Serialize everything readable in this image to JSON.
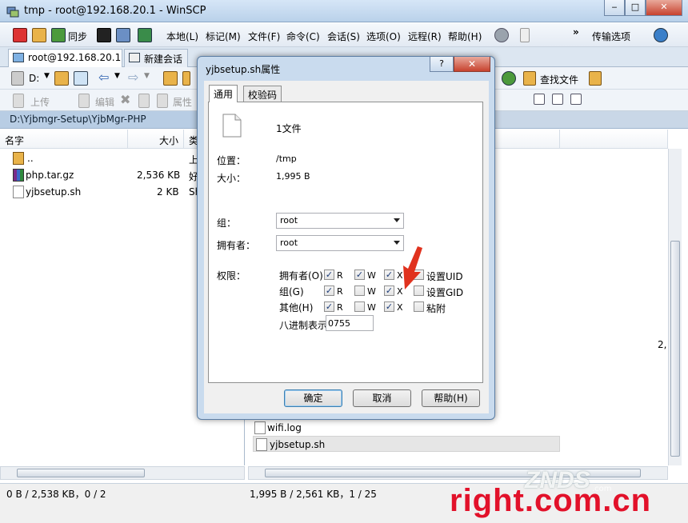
{
  "window": {
    "title": "tmp - root@192.168.20.1 - WinSCP",
    "minimize": "‒",
    "maximize": "□",
    "close": "✕"
  },
  "menu": {
    "sync_label": "同步",
    "items": [
      "本地(L)",
      "标记(M)",
      "文件(F)",
      "命令(C)",
      "会话(S)",
      "选项(O)",
      "远程(R)",
      "帮助(H)"
    ],
    "overflow": "»",
    "transfer_options": "传输选项"
  },
  "tabs": {
    "session": "root@192.168.20.1",
    "new_session": "新建会话"
  },
  "left_toolbar": {
    "drive": "D:",
    "upload": "上传",
    "edit": "编辑",
    "properties": "属性"
  },
  "right_toolbar": {
    "find_files": "查找文件"
  },
  "left_panel": {
    "path": "D:\\Yjbmgr-Setup\\YjbMgr-PHP",
    "columns": {
      "name": "名字",
      "size": "大小",
      "type_partial": "类"
    },
    "rows": [
      {
        "name": "..",
        "size": "",
        "type": "上"
      },
      {
        "name": "php.tar.gz",
        "size": "2,536 KB",
        "type": "好"
      },
      {
        "name": "yjbsetup.sh",
        "size": "2 KB",
        "type": "Sh"
      }
    ]
  },
  "right_panel": {
    "rows": [
      {
        "name": "wifi.log"
      },
      {
        "name": "yjbsetup.sh"
      }
    ],
    "edge_text": "2,"
  },
  "status": {
    "left": "0 B / 2,538 KB，0 / 2",
    "right": "1,995 B / 2,561 KB，1 / 25"
  },
  "dialog": {
    "title": "yjbsetup.sh属性",
    "help": "?",
    "close": "✕",
    "tabs": {
      "general": "通用",
      "checksum": "校验码"
    },
    "file_count": "1文件",
    "location_label": "位置：",
    "location_value": "/tmp",
    "size_label": "大小：",
    "size_value": "1,995 B",
    "group_label": "组：",
    "group_value": "root",
    "owner_label": "拥有者：",
    "owner_value": "root",
    "perms_label": "权限：",
    "perm_rows": [
      {
        "label": "拥有者(O)",
        "r": "R",
        "w": "W",
        "x": "X",
        "extra": "设置UID",
        "r_checked": true,
        "w_checked": true,
        "x_checked": true,
        "extra_checked": false
      },
      {
        "label": "组(G)",
        "r": "R",
        "w": "W",
        "x": "X",
        "extra": "设置GID",
        "r_checked": true,
        "w_checked": false,
        "x_checked": true,
        "extra_checked": false
      },
      {
        "label": "其他(H)",
        "r": "R",
        "w": "W",
        "x": "X",
        "extra": "粘附",
        "r_checked": true,
        "w_checked": false,
        "x_checked": true,
        "extra_checked": false
      }
    ],
    "octal_label": "八进制表示",
    "octal_value": "0755",
    "buttons": {
      "ok": "确定",
      "cancel": "取消",
      "help": "帮助(H)"
    }
  },
  "watermark": {
    "text": "right.com.cn",
    "logo": "ZNDS",
    "logo_sub": ".com"
  },
  "colors": {
    "accent": "#c7422e",
    "watermark": "#e2112a",
    "check": "#1a3a78"
  }
}
